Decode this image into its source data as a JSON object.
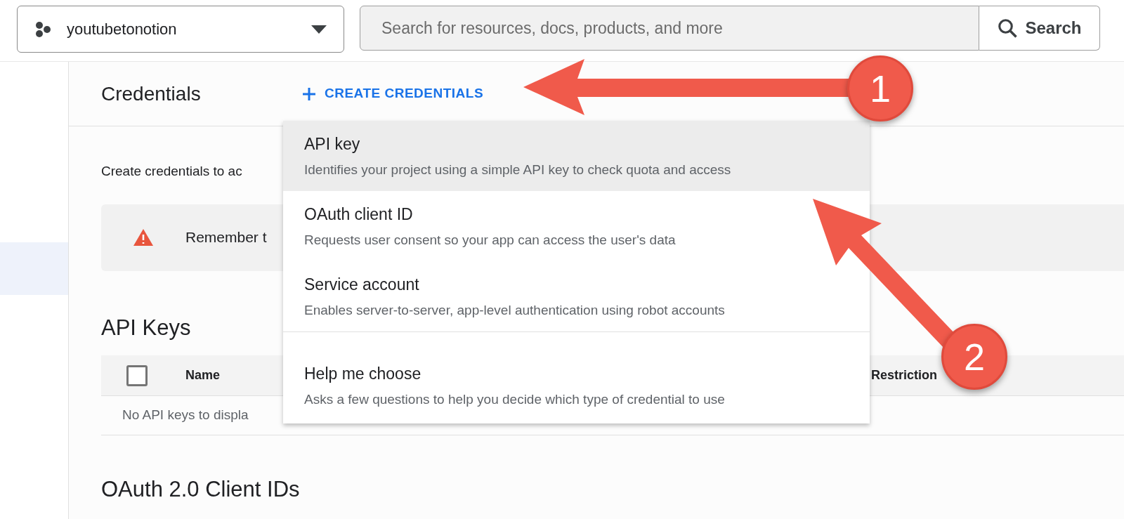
{
  "project_selector": {
    "name": "youtubetonotion"
  },
  "search": {
    "placeholder": "Search for resources, docs, products, and more",
    "button": "Search"
  },
  "header": {
    "title": "Credentials",
    "actions": [
      {
        "label": "CREATE CREDENTIALS",
        "kind": "primary"
      }
    ]
  },
  "intro": "Create credentials to ac",
  "warning": {
    "text": "Remember t"
  },
  "api_keys": {
    "title": "API Keys",
    "checkbox": {
      "checked": false
    },
    "columns": [
      "Name",
      "Restriction"
    ],
    "empty": "No API keys to displa"
  },
  "oauth": {
    "title": "OAuth 2.0 Client IDs"
  },
  "menu": {
    "items": [
      {
        "kind": "option",
        "title": "API key",
        "description": "Identifies your project using a simple API key to check quota and access",
        "selected": true
      },
      {
        "kind": "option",
        "title": "OAuth client ID",
        "description": "Requests user consent so your app can access the user's data",
        "selected": false
      },
      {
        "kind": "option",
        "title": "Service account",
        "description": "Enables server-to-server, app-level authentication using robot accounts",
        "selected": false
      },
      {
        "kind": "help",
        "title": "Help me choose",
        "description": "Asks a few questions to help you decide which type of credential to use",
        "selected": false
      }
    ]
  },
  "annotations": [
    {
      "number": "1"
    },
    {
      "number": "2"
    }
  ]
}
